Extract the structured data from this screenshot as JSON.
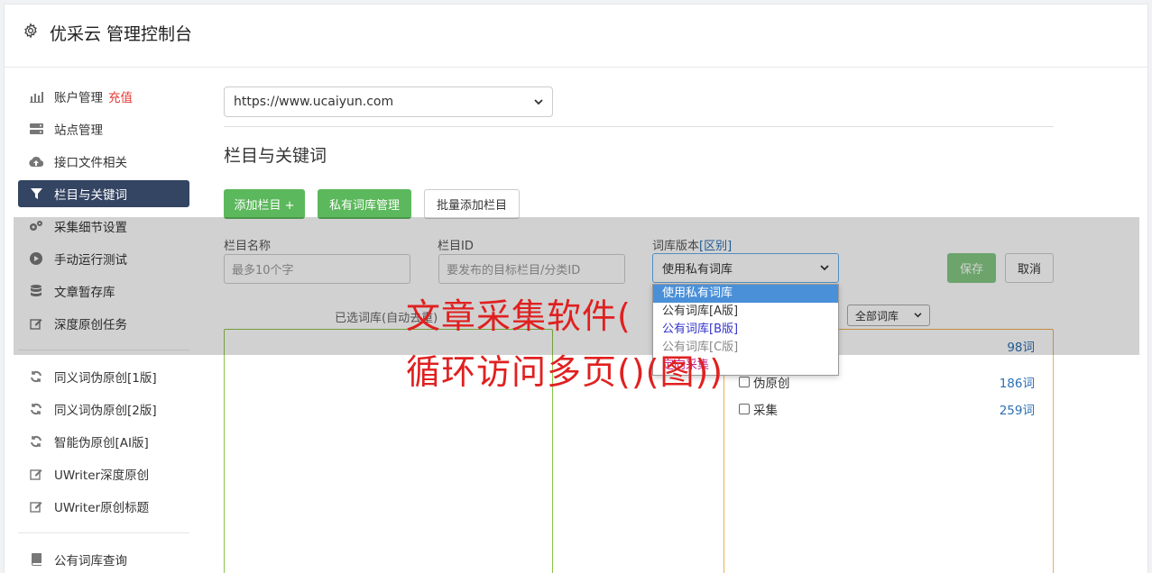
{
  "app": {
    "title": "优采云 管理控制台"
  },
  "sidebar": {
    "items": [
      {
        "label": "账户管理",
        "extra": "充值",
        "icon": "bar-chart-icon"
      },
      {
        "label": "站点管理",
        "icon": "server-icon"
      },
      {
        "label": "接口文件相关",
        "icon": "cloud-upload-icon"
      },
      {
        "label": "栏目与关键词",
        "icon": "filter-icon",
        "active": true
      },
      {
        "label": "采集细节设置",
        "icon": "cogs-icon"
      },
      {
        "label": "手动运行测试",
        "icon": "play-circle-icon"
      },
      {
        "label": "文章暂存库",
        "icon": "database-icon"
      },
      {
        "label": "深度原创任务",
        "icon": "edit-icon"
      }
    ],
    "items2": [
      {
        "label": "同义词伪原创[1版]",
        "icon": "refresh-icon"
      },
      {
        "label": "同义词伪原创[2版]",
        "icon": "refresh-icon"
      },
      {
        "label": "智能伪原创[AI版]",
        "icon": "refresh-icon"
      },
      {
        "label": "UWriter深度原创",
        "icon": "edit-icon"
      },
      {
        "label": "UWriter原创标题",
        "icon": "edit-icon"
      }
    ],
    "items3": [
      {
        "label": "公有词库查询",
        "icon": "book-icon"
      }
    ]
  },
  "main": {
    "site_select": "https://www.ucaiyun.com",
    "section_title": "栏目与关键词",
    "buttons": {
      "add_column": "添加栏目 +",
      "private_lib": "私有词库管理",
      "batch_add": "批量添加栏目",
      "save": "保存",
      "cancel": "取消"
    },
    "form": {
      "name_label": "栏目名称",
      "name_placeholder": "最多10个字",
      "id_label": "栏目ID",
      "id_placeholder": "要发布的目标栏目/分类ID",
      "version_label": "词库版本",
      "version_link": "[区别]",
      "version_value": "使用私有词库"
    },
    "dropdown_options": [
      "使用私有词库",
      "公有词库[A版]",
      "公有词库[B版]",
      "公有词库[C版]",
      "定向采集"
    ],
    "selected_label": "已选词库(自动去重)",
    "filter_select": "全部词库",
    "libraries": [
      {
        "name": "伪原创",
        "count": "186词"
      },
      {
        "name": "采集",
        "count": "259词"
      }
    ],
    "first_count": "98词"
  },
  "watermark": {
    "line1": "文章采集软件(",
    "line2": "循环访问多页()(图))"
  },
  "colors": {
    "active_nav": "#344563",
    "green_button": "#5cb85c",
    "accent_red": "#e53935"
  }
}
